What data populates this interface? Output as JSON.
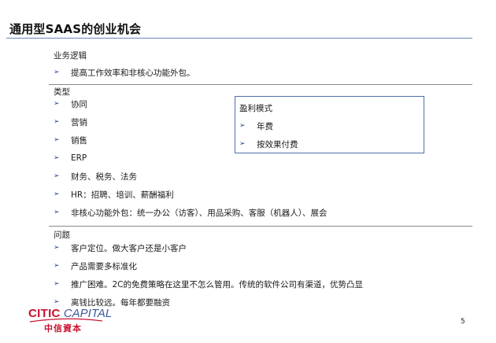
{
  "slide": {
    "title": "通用型SAAS的创业机会",
    "page_number": "5"
  },
  "logic": {
    "label": "业务逻辑",
    "items": [
      "提高工作效率和非核心功能外包。"
    ]
  },
  "types": {
    "label": "类型",
    "items": [
      "协同",
      "营销",
      "销售",
      "ERP",
      "财务、税务、法务",
      "HR：招聘、培训、薪酬福利",
      "非核心功能外包：统一办公（访客）、用品采购、客服（机器人）、展会"
    ]
  },
  "profit": {
    "label": "盈利模式",
    "items": [
      "年费",
      "按效果付费"
    ]
  },
  "issues": {
    "label": "问题",
    "items": [
      "客户定位。做大客户还是小客户",
      "产品需要多标准化",
      "推广困难。2C的免费策略在这里不怎么管用。传统的软件公司有渠道，优势凸显",
      "离钱比较远。每年都要融资"
    ]
  },
  "logo": {
    "line1_brand": "CITIC",
    "line1_word": "CAPITAL",
    "line2": "中信資本"
  },
  "colors": {
    "title_rule": "#6b86b8",
    "bullet": "#1f3f8f",
    "box_border": "#4e6fae",
    "logo_red": "#c8102e",
    "logo_blue": "#3a5a9c"
  },
  "icons": {
    "bullet": "arrowhead-bullet-icon"
  }
}
